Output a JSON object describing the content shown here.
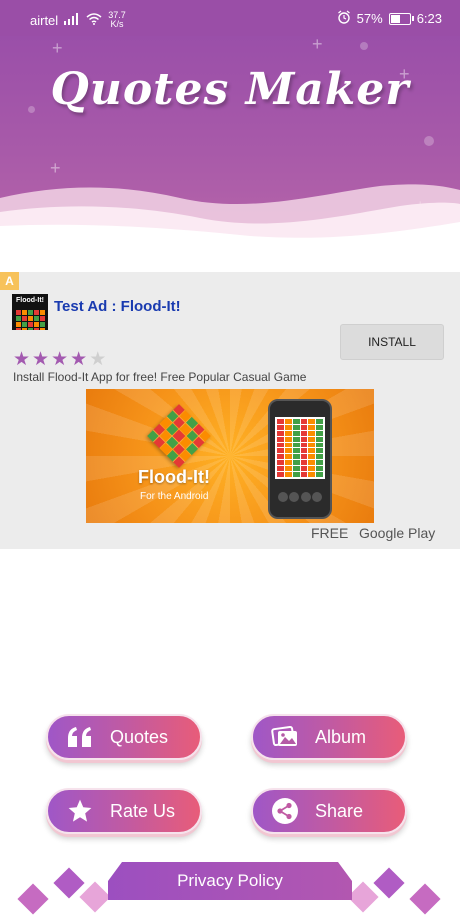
{
  "status_bar": {
    "carrier": "airtel",
    "speed_value": "37.7",
    "speed_unit": "K/s",
    "battery": "57%",
    "battery_level": 0.57,
    "time": "6:23"
  },
  "header": {
    "title": "Quotes Maker"
  },
  "ad": {
    "badge": "A",
    "icon_text": "Flood-It!",
    "title": "Test Ad : Flood-It!",
    "install_label": "INSTALL",
    "rating": 4,
    "rating_max": 5,
    "description": "Install Flood-It App for free! Free Popular Casual Game",
    "banner_name": "Flood-It!",
    "banner_sub": "For the Android",
    "price": "FREE",
    "store": "Google Play"
  },
  "menu": {
    "quotes_label": "Quotes",
    "album_label": "Album",
    "rate_label": "Rate Us",
    "share_label": "Share",
    "privacy_label": "Privacy Policy"
  },
  "colors": {
    "header_purple": "#9a4ea7",
    "button_start": "#9f57c7",
    "button_end": "#e85c79",
    "ad_title_blue": "#1a3bb0",
    "star": "#a35ab0"
  }
}
